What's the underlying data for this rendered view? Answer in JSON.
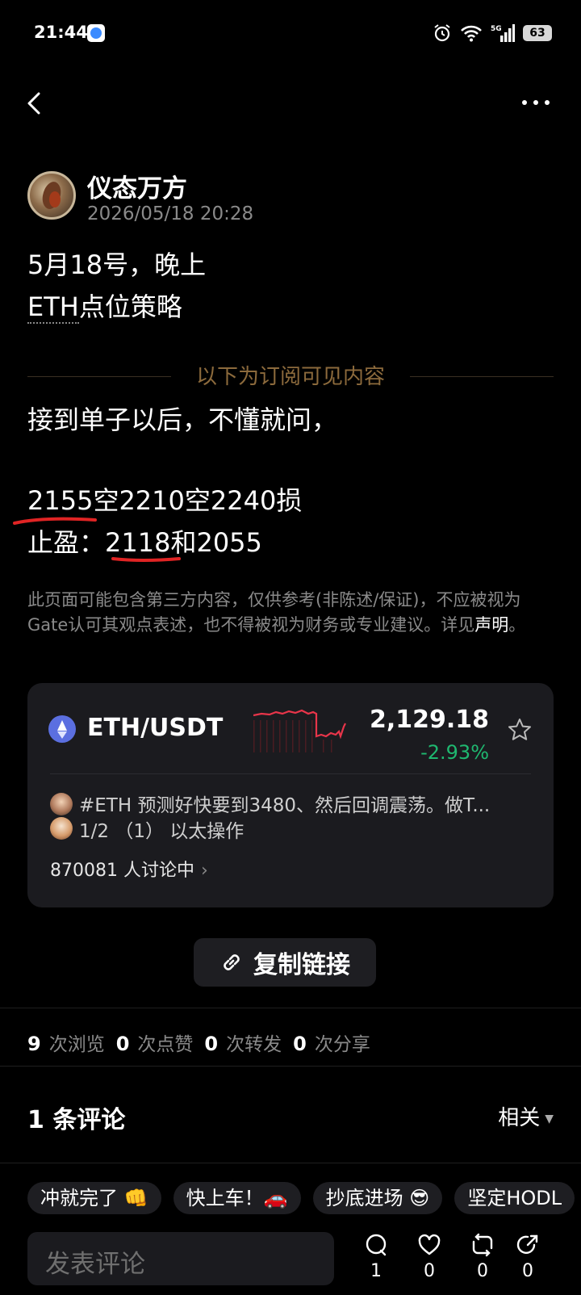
{
  "status_bar": {
    "time": "21:44",
    "battery": "63",
    "signal_label": "5G",
    "icons": [
      "alarm-icon",
      "wifi-icon",
      "signal-icon",
      "battery-icon"
    ]
  },
  "nav": {
    "back_icon": "chevron-left-icon",
    "more_icon": "more-dots-icon"
  },
  "author": {
    "name": "仪态万方",
    "time": "2026/05/18 20:28"
  },
  "post": {
    "line1": "5月18号，晚上",
    "line2_ticker": "ETH",
    "line2_rest": "点位策略",
    "divider_label": "以下为订阅可见内容",
    "body1": "接到单子以后，不懂就问，",
    "body2": "2155空2210空2240损",
    "body3_label": "止盈：",
    "body3_value": "2118和2055"
  },
  "disclaimer": {
    "text": "此页面可能包含第三方内容，仅供参考(非陈述/保证)，不应被视为Gate认可其观点表述，也不得被视为财务或专业建议。详见",
    "link": "声明",
    "end": "。"
  },
  "ticker": {
    "pair": "ETH/USDT",
    "price": "2,129.18",
    "change": "-2.93%",
    "change_color": "#1fb870",
    "sparkline_color": "#e8354a",
    "topic_line1": "#ETH 预测好快要到3480、然后回调震荡。做T...",
    "topic_line2": "1/2 （1） 以太操作",
    "discussing": "870081 人讨论中",
    "discussing_chevron": "›"
  },
  "copy_link": {
    "label": "复制链接",
    "icon": "link-icon"
  },
  "stats": [
    {
      "count": "9",
      "label": "次浏览"
    },
    {
      "count": "0",
      "label": "次点赞"
    },
    {
      "count": "0",
      "label": "次转发"
    },
    {
      "count": "0",
      "label": "次分享"
    }
  ],
  "comments": {
    "title": "1 条评论",
    "sort": "相关"
  },
  "quick_replies": [
    "冲就完了 👊",
    "快上车！🚗",
    "抄底进场 😎",
    "坚定HODL"
  ],
  "composer": {
    "placeholder": "发表评论"
  },
  "actions": [
    {
      "icon": "comment-icon",
      "count": "1"
    },
    {
      "icon": "heart-icon",
      "count": "0"
    },
    {
      "icon": "repost-icon",
      "count": "0"
    },
    {
      "icon": "share-icon",
      "count": "0"
    }
  ],
  "colors": {
    "background": "#000000",
    "accent_gold": "#8c6a3c",
    "positive_green": "#1fb870",
    "annotation_red": "#e02424"
  }
}
